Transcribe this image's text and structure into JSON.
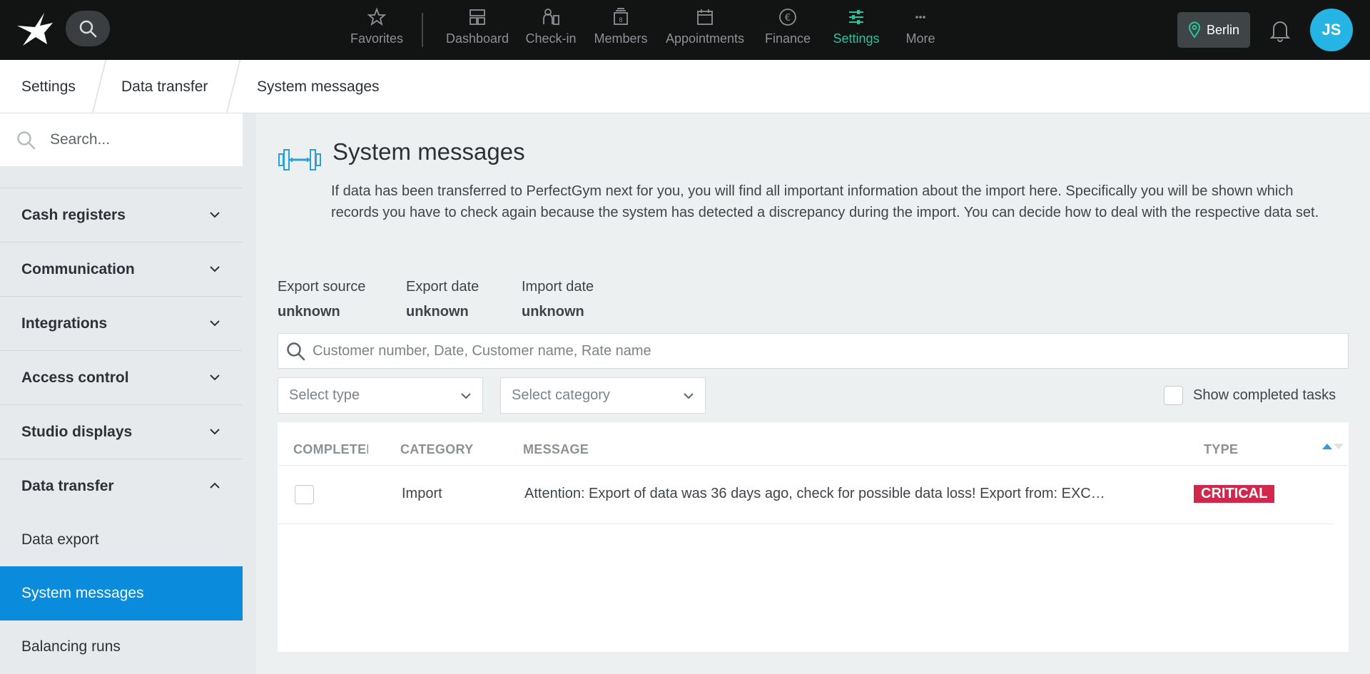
{
  "topbar": {
    "nav": [
      {
        "label": "Favorites",
        "icon": "star-icon"
      },
      {
        "label": "Dashboard",
        "icon": "dashboard-icon"
      },
      {
        "label": "Check-in",
        "icon": "check-in-icon"
      },
      {
        "label": "Members",
        "icon": "members-icon"
      },
      {
        "label": "Appointments",
        "icon": "calendar-icon"
      },
      {
        "label": "Finance",
        "icon": "euro-icon"
      },
      {
        "label": "Settings",
        "icon": "sliders-icon",
        "active": true
      },
      {
        "label": "More",
        "icon": "more-icon"
      }
    ],
    "location": "Berlin",
    "avatar_initials": "JS",
    "accent_color": "#27c49d"
  },
  "breadcrumb": [
    "Settings",
    "Data transfer",
    "System messages"
  ],
  "sidebar": {
    "search_placeholder": "Search...",
    "items": [
      {
        "label": "Cash registers",
        "expanded": false
      },
      {
        "label": "Communication",
        "expanded": false
      },
      {
        "label": "Integrations",
        "expanded": false
      },
      {
        "label": "Access control",
        "expanded": false
      },
      {
        "label": "Studio displays",
        "expanded": false
      },
      {
        "label": "Data transfer",
        "expanded": true
      }
    ],
    "subitems": [
      {
        "label": "Data export",
        "active": false
      },
      {
        "label": "System messages",
        "active": true
      },
      {
        "label": "Balancing runs",
        "active": false
      }
    ]
  },
  "main": {
    "title": "System messages",
    "intro": "If data has been transferred to PerfectGym next for you, you will find all important information about the import here. Specifically you will be shown which records you have to check again because the system has detected a discrepancy during the import. You can decide how to deal with the respective data set.",
    "meta": [
      {
        "label": "Export source",
        "value": "unknown"
      },
      {
        "label": "Export date",
        "value": "unknown"
      },
      {
        "label": "Import date",
        "value": "unknown"
      }
    ],
    "search_placeholder": "Customer number, Date, Customer name, Rate name",
    "type_select": "Select type",
    "category_select": "Select category",
    "show_completed_label": "Show completed tasks",
    "table": {
      "headers": [
        "COMPLETED",
        "CATEGORY",
        "MESSAGE",
        "TYPE"
      ],
      "rows": [
        {
          "completed": false,
          "category": "Import",
          "message": "Attention: Export of data was 36 days ago, check for possible data loss! Export from: EXC…",
          "type": "CRITICAL"
        }
      ]
    }
  }
}
